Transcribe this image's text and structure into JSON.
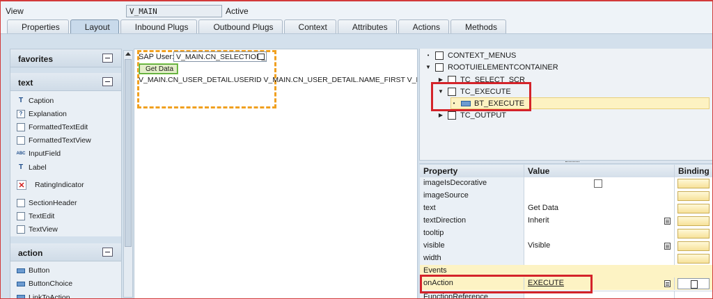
{
  "header": {
    "view_label": "View",
    "view_name": "V_MAIN",
    "status": "Active"
  },
  "tabs": [
    {
      "label": "Properties"
    },
    {
      "label": "Layout",
      "active": true
    },
    {
      "label": "Inbound Plugs"
    },
    {
      "label": "Outbound Plugs"
    },
    {
      "label": "Context"
    },
    {
      "label": "Attributes"
    },
    {
      "label": "Actions"
    },
    {
      "label": "Methods"
    }
  ],
  "palette": {
    "favorites_title": "favorites",
    "text_title": "text",
    "text_items": [
      {
        "label": "Caption",
        "icon": "caption-icon"
      },
      {
        "label": "Explanation",
        "icon": "explanation-icon"
      },
      {
        "label": "FormattedTextEdit",
        "icon": "formatted-text-edit-icon"
      },
      {
        "label": "FormattedTextView",
        "icon": "formatted-text-view-icon"
      },
      {
        "label": "InputField",
        "icon": "input-field-icon"
      },
      {
        "label": "Label",
        "icon": "label-icon"
      },
      {
        "label": "RatingIndicator",
        "icon": "rating-indicator-icon"
      },
      {
        "label": "SectionHeader",
        "icon": "section-header-icon"
      },
      {
        "label": "TextEdit",
        "icon": "text-edit-icon"
      },
      {
        "label": "TextView",
        "icon": "text-view-icon"
      }
    ],
    "action_title": "action",
    "action_items": [
      {
        "label": "Button",
        "icon": "button-icon"
      },
      {
        "label": "ButtonChoice",
        "icon": "button-choice-icon"
      },
      {
        "label": "LinkToAction",
        "icon": "link-icon"
      }
    ]
  },
  "canvas": {
    "sap_user_label": "SAP User:",
    "sap_user_value": "V_MAIN.CN_SELECTION_",
    "get_data_label": "Get Data",
    "bound_text": "V_MAIN.CN_USER_DETAIL.USERID V_MAIN.CN_USER_DETAIL.NAME_FIRST V_MAIN.CN_USER_DETAIL.NAME_LAST"
  },
  "tree": [
    {
      "label": "CONTEXT_MENUS"
    },
    {
      "label": "ROOTUIELEMENTCONTAINER"
    },
    {
      "label": "TC_SELECT_SCR"
    },
    {
      "label": "TC_EXECUTE"
    },
    {
      "label": "BT_EXECUTE"
    },
    {
      "label": "TC_OUTPUT"
    }
  ],
  "properties": {
    "col_property": "Property",
    "col_value": "Value",
    "col_binding": "Binding",
    "rows": [
      {
        "name": "imageIsDecorative",
        "value": ""
      },
      {
        "name": "imageSource",
        "value": ""
      },
      {
        "name": "text",
        "value": "Get Data"
      },
      {
        "name": "textDirection",
        "value": "Inherit"
      },
      {
        "name": "tooltip",
        "value": ""
      },
      {
        "name": "visible",
        "value": "Visible"
      },
      {
        "name": "width",
        "value": ""
      }
    ],
    "events_label": "Events",
    "event_name": "onAction",
    "event_value": "EXECUTE",
    "next_row_label": "FunctionReference"
  },
  "colors": {
    "highlight_red": "#d4232a",
    "selection_orange": "#f0a020",
    "binding_yellow": "#f7e29a"
  }
}
